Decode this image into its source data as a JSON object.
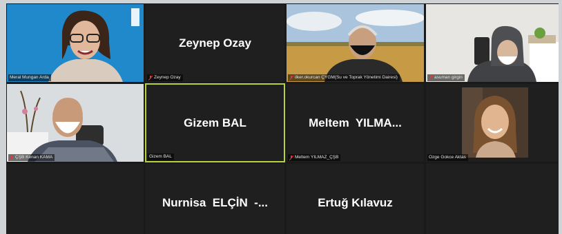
{
  "participants": [
    {
      "name": "Meral Mungan Arda",
      "muted": false,
      "video": true
    },
    {
      "name": "Zeynep Ozay",
      "display_name": "Zeynep Ozay",
      "muted": true,
      "video": false
    },
    {
      "name": "ilker.okurcan ÇYGM(Su ve Toprak Yönetimi Dairesi)",
      "muted": true,
      "video": true
    },
    {
      "name": "asuman girgin",
      "muted": true,
      "video": true
    },
    {
      "name": "ÇŞB Kenan KAMA",
      "muted": true,
      "video": true
    },
    {
      "name": "Gizem BAL",
      "display_name": "Gizem BAL",
      "muted": false,
      "video": false,
      "active_speaker": true
    },
    {
      "name": "Meltem YILMAZ_ÇŞB",
      "display_name": "Meltem  YILMA...",
      "muted": true,
      "video": false
    },
    {
      "name": "Ozge Gokce Aktas",
      "muted": false,
      "video": true
    },
    {
      "display_name": "Nurnisa  ELÇİN  -...",
      "video": false
    },
    {
      "display_name": "Ertuğ Kılavuz",
      "video": false
    }
  ],
  "colors": {
    "active_border": "#b5d33a",
    "muted_icon": "#e0383b",
    "tile_bg": "#1f1f1f"
  }
}
